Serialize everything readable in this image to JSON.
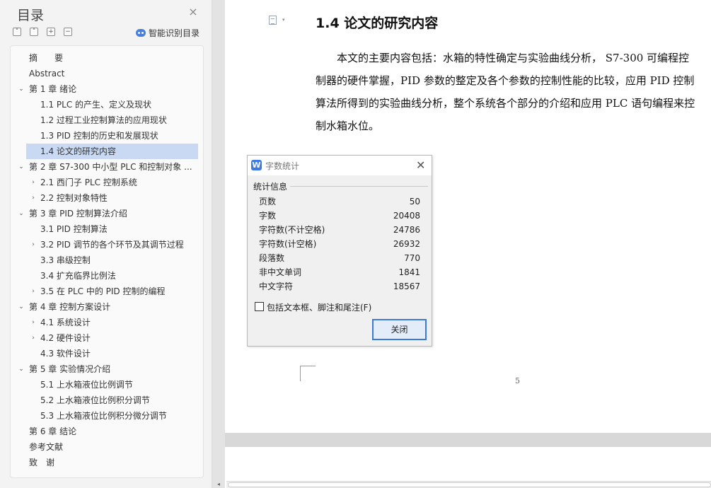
{
  "toc_panel": {
    "title": "目录",
    "close_glyph": "×",
    "tools": {
      "collapse_all": "˅",
      "expand_all": "˄",
      "add": "+",
      "remove": "−"
    },
    "smart_toc_label": "智能识别目录",
    "items": [
      {
        "label": "摘　　要",
        "level": 1,
        "expander": ""
      },
      {
        "label": "Abstract",
        "level": 1,
        "expander": ""
      },
      {
        "label": "第 1 章  绪论",
        "level": 1,
        "expander": "⌄"
      },
      {
        "label": "1.1 PLC 的产生、定义及现状",
        "level": 2,
        "expander": ""
      },
      {
        "label": "1.2 过程工业控制算法的应用现状",
        "level": 2,
        "expander": ""
      },
      {
        "label": "1.3 PID 控制的历史和发展现状",
        "level": 2,
        "expander": ""
      },
      {
        "label": "1.4  论文的研究内容",
        "level": 2,
        "expander": "",
        "selected": true
      },
      {
        "label": "第 2 章  S7-300 中小型 PLC 和控制对象 ...",
        "level": 1,
        "expander": "⌄"
      },
      {
        "label": "2.1  西门子 PLC 控制系统",
        "level": 2,
        "expander": "›"
      },
      {
        "label": "2.2  控制对象特性",
        "level": 2,
        "expander": "›"
      },
      {
        "label": "第 3 章  PID 控制算法介绍",
        "level": 1,
        "expander": "⌄"
      },
      {
        "label": "3.1 PID 控制算法",
        "level": 2,
        "expander": ""
      },
      {
        "label": "3.2 PID 调节的各个环节及其调节过程",
        "level": 2,
        "expander": "›"
      },
      {
        "label": "3.3  串级控制",
        "level": 2,
        "expander": ""
      },
      {
        "label": "3.4  扩充临界比例法",
        "level": 2,
        "expander": ""
      },
      {
        "label": "3.5 在 PLC 中的 PID 控制的编程",
        "level": 2,
        "expander": "›"
      },
      {
        "label": "第 4 章  控制方案设计",
        "level": 1,
        "expander": "⌄"
      },
      {
        "label": "4.1  系统设计",
        "level": 2,
        "expander": "›"
      },
      {
        "label": "4.2  硬件设计",
        "level": 2,
        "expander": "›"
      },
      {
        "label": "4.3  软件设计",
        "level": 2,
        "expander": ""
      },
      {
        "label": "第 5 章    实验情况介绍",
        "level": 1,
        "expander": "⌄"
      },
      {
        "label": "5.1  上水箱液位比例调节",
        "level": 2,
        "expander": ""
      },
      {
        "label": "5.2  上水箱液位比例积分调节",
        "level": 2,
        "expander": ""
      },
      {
        "label": "5.3  上水箱液位比例积分微分调节",
        "level": 2,
        "expander": ""
      },
      {
        "label": "第 6 章  结论",
        "level": 1,
        "expander": ""
      },
      {
        "label": "参考文献",
        "level": 1,
        "expander": ""
      },
      {
        "label": "致　谢",
        "level": 1,
        "expander": ""
      }
    ]
  },
  "document": {
    "heading": "1.4  论文的研究内容",
    "paragraph_lines": [
      "　　本文的主要内容包括：水箱的特性确定与实验曲线分析，  S7-300 可编程控",
      "制器的硬件掌握，PID 参数的整定及各个参数的控制性能的比较，应用 PID 控制",
      "算法所得到的实验曲线分析，整个系统各个部分的介绍和应用 PLC 语句编程来控",
      "制水箱水位。"
    ],
    "page_number": "5",
    "style_dropdown_arrow": "▾"
  },
  "word_count_dialog": {
    "app_icon_letter": "W",
    "title": "字数统计",
    "close_glyph": "✕",
    "group_label": "统计信息",
    "stats": [
      {
        "label": "页数",
        "value": "50"
      },
      {
        "label": "字数",
        "value": "20408"
      },
      {
        "label": "字符数(不计空格)",
        "value": "24786"
      },
      {
        "label": "字符数(计空格)",
        "value": "26932"
      },
      {
        "label": "段落数",
        "value": "770"
      },
      {
        "label": "非中文单词",
        "value": "1841"
      },
      {
        "label": "中文字符",
        "value": "18567"
      }
    ],
    "checkbox_label": "包括文本框、脚注和尾注(F)",
    "checkbox_checked": false,
    "close_button_label": "关闭"
  },
  "scrollbar": {
    "left_arrow": "◂"
  }
}
